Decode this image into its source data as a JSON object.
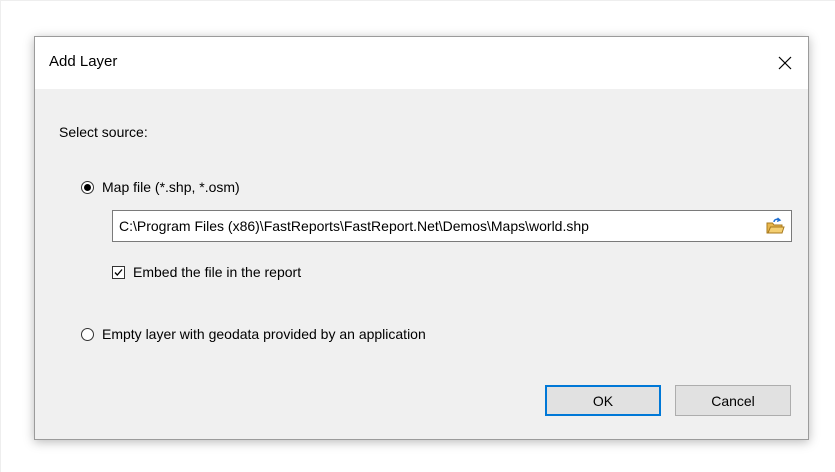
{
  "dialog": {
    "title": "Add Layer",
    "close_icon": "close-icon",
    "select_source_label": "Select source:",
    "options": [
      {
        "label": "Map file (*.shp, *.osm)",
        "selected": true
      },
      {
        "label": "Empty layer with geodata provided by an application",
        "selected": false
      }
    ],
    "file_path": {
      "value": "C:\\Program Files (x86)\\FastReports\\FastReport.Net\\Demos\\Maps\\world.shp",
      "browse_icon": "open-folder-icon"
    },
    "embed_checkbox": {
      "label": "Embed the file in the report",
      "checked": true
    },
    "buttons": {
      "ok": "OK",
      "cancel": "Cancel"
    },
    "colors": {
      "accent": "#0078d7",
      "dialog_background": "#f0f0f0",
      "title_background": "#ffffff",
      "button_face": "#e1e1e1",
      "folder_yellow": "#e8b64c"
    }
  }
}
